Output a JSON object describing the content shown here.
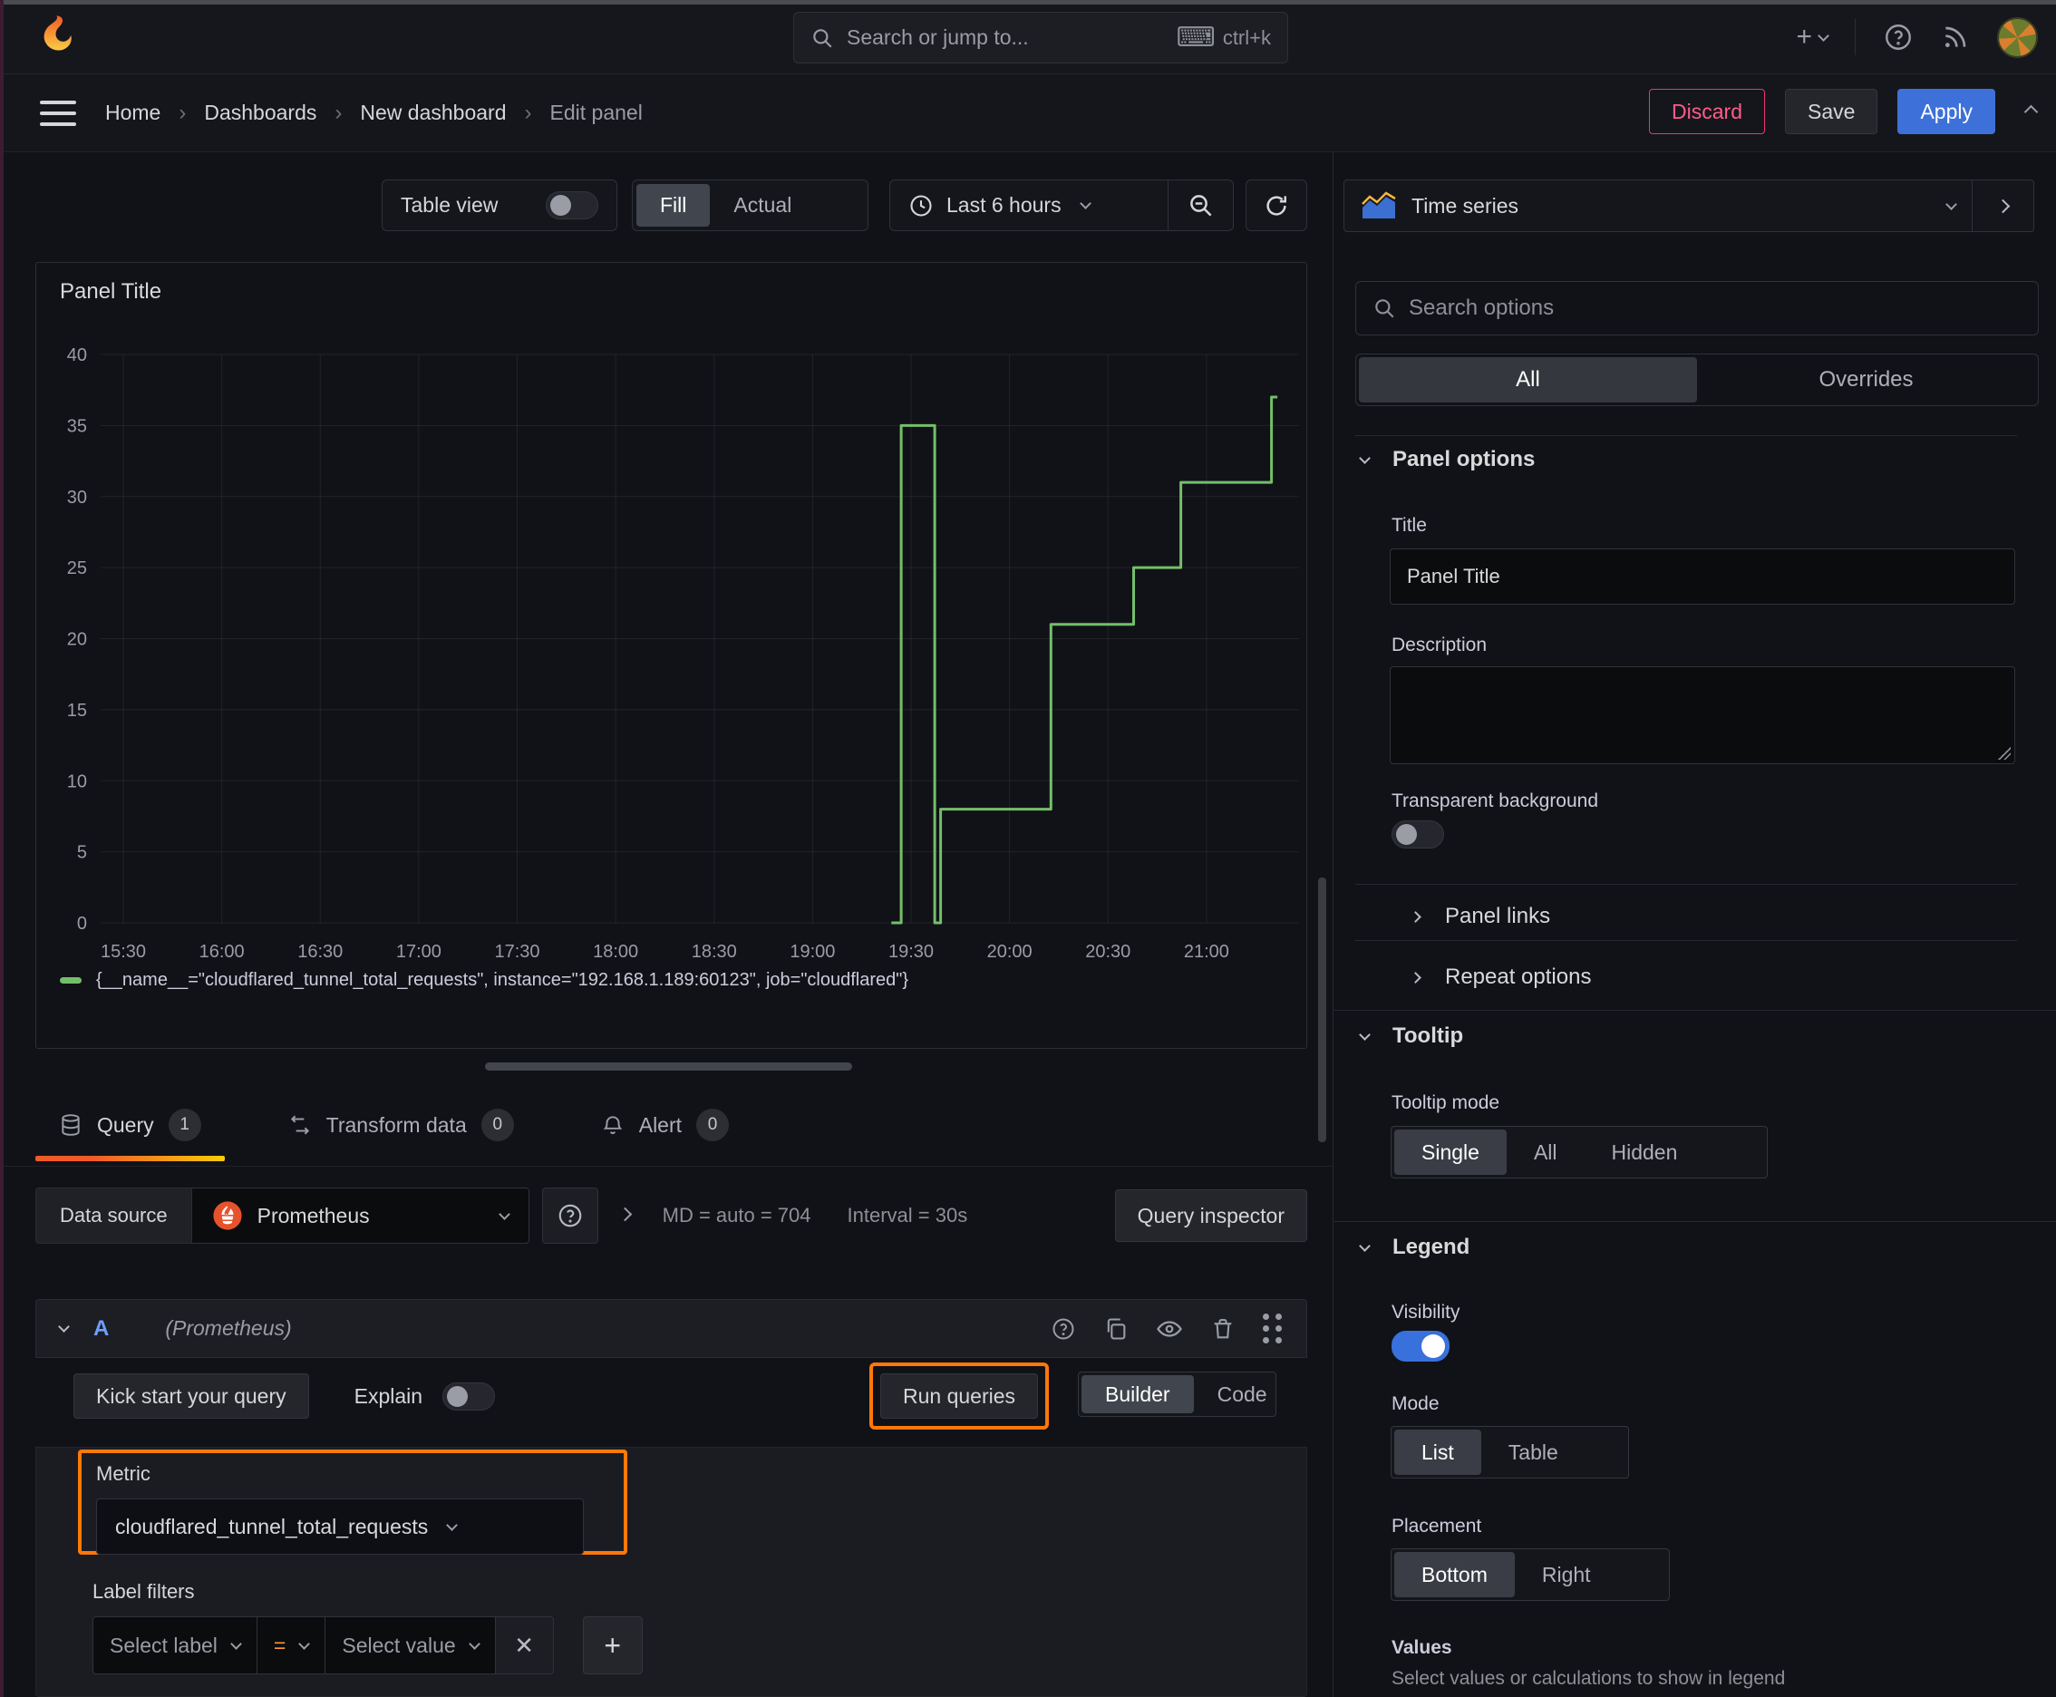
{
  "colors": {
    "accent_blue": "#3D71D9",
    "highlight_orange": "#FF780A",
    "series_green": "#73BF69",
    "discard_pink": "#FF5C8A"
  },
  "topnav": {
    "search": {
      "placeholder": "Search or jump to...",
      "shortcut": "ctrl+k"
    }
  },
  "breadcrumb": {
    "items": [
      {
        "label": "Home"
      },
      {
        "label": "Dashboards"
      },
      {
        "label": "New dashboard"
      },
      {
        "label": "Edit panel"
      }
    ],
    "discard": "Discard",
    "save": "Save",
    "apply": "Apply"
  },
  "panel_toolbar": {
    "table_view": "Table view",
    "fill": "Fill",
    "actual": "Actual",
    "time_range": "Last 6 hours"
  },
  "panel": {
    "title": "Panel Title"
  },
  "chart_data": {
    "type": "line",
    "line_style": "step",
    "title": "Panel Title",
    "xlabel": "",
    "ylabel": "",
    "ylim": [
      0,
      40
    ],
    "y_ticks": [
      0,
      5,
      10,
      15,
      20,
      25,
      30,
      35,
      40
    ],
    "x_ticks": [
      "15:30",
      "16:00",
      "16:30",
      "17:00",
      "17:30",
      "18:00",
      "18:30",
      "19:00",
      "19:30",
      "20:00",
      "20:30",
      "21:00"
    ],
    "x_tick_hours": [
      15.5,
      16.0,
      16.5,
      17.0,
      17.5,
      18.0,
      18.5,
      19.0,
      19.5,
      20.0,
      20.5,
      21.0
    ],
    "x_range_hours": [
      15.385,
      21.47
    ],
    "grid": true,
    "legend_position": "bottom",
    "series": [
      {
        "name": "{__name__=\"cloudflared_tunnel_total_requests\", instance=\"192.168.1.189:60123\", job=\"cloudflared\"}",
        "color": "#73BF69",
        "points_hours_value": [
          [
            19.4,
            0
          ],
          [
            19.45,
            0
          ],
          [
            19.45,
            35
          ],
          [
            19.62,
            35
          ],
          [
            19.62,
            0
          ],
          [
            19.65,
            0
          ],
          [
            19.65,
            8
          ],
          [
            20.21,
            8
          ],
          [
            20.21,
            21
          ],
          [
            20.63,
            21
          ],
          [
            20.63,
            25
          ],
          [
            20.87,
            25
          ],
          [
            20.87,
            31
          ],
          [
            21.33,
            31
          ],
          [
            21.33,
            37
          ],
          [
            21.36,
            37
          ]
        ]
      }
    ]
  },
  "query_tabs": {
    "query": {
      "label": "Query",
      "badge": "1"
    },
    "transform": {
      "label": "Transform data",
      "badge": "0"
    },
    "alert": {
      "label": "Alert",
      "badge": "0"
    }
  },
  "datasource_row": {
    "label": "Data source",
    "value": "Prometheus",
    "meta_md": "MD = auto = 704",
    "meta_interval": "Interval = 30s",
    "query_inspector": "Query inspector"
  },
  "query_row": {
    "ref_id": "A",
    "datasource_hint": "(Prometheus)"
  },
  "query_toolbar": {
    "kick_start": "Kick start your query",
    "explain": "Explain",
    "run_queries": "Run queries",
    "builder": "Builder",
    "code": "Code"
  },
  "metric_section": {
    "metric_label": "Metric",
    "metric_value": "cloudflared_tunnel_total_requests",
    "label_filters_label": "Label filters",
    "select_label": "Select label",
    "operator": "=",
    "select_value": "Select value"
  },
  "sidebar": {
    "visualization": "Time series",
    "search_placeholder": "Search options",
    "tabs": {
      "all": "All",
      "overrides": "Overrides"
    },
    "panel_options": {
      "heading": "Panel options",
      "title_label": "Title",
      "title_value": "Panel Title",
      "description_label": "Description",
      "transparent_label": "Transparent background"
    },
    "links": {
      "panel_links": "Panel links",
      "repeat_options": "Repeat options"
    },
    "tooltip": {
      "heading": "Tooltip",
      "mode_label": "Tooltip mode",
      "options": [
        "Single",
        "All",
        "Hidden"
      ],
      "selected": "Single"
    },
    "legend": {
      "heading": "Legend",
      "visibility_label": "Visibility",
      "mode_label": "Mode",
      "mode_options": [
        "List",
        "Table"
      ],
      "placement_label": "Placement",
      "placement_options": [
        "Bottom",
        "Right"
      ],
      "values_label": "Values",
      "values_hint": "Select values or calculations to show in legend"
    }
  }
}
